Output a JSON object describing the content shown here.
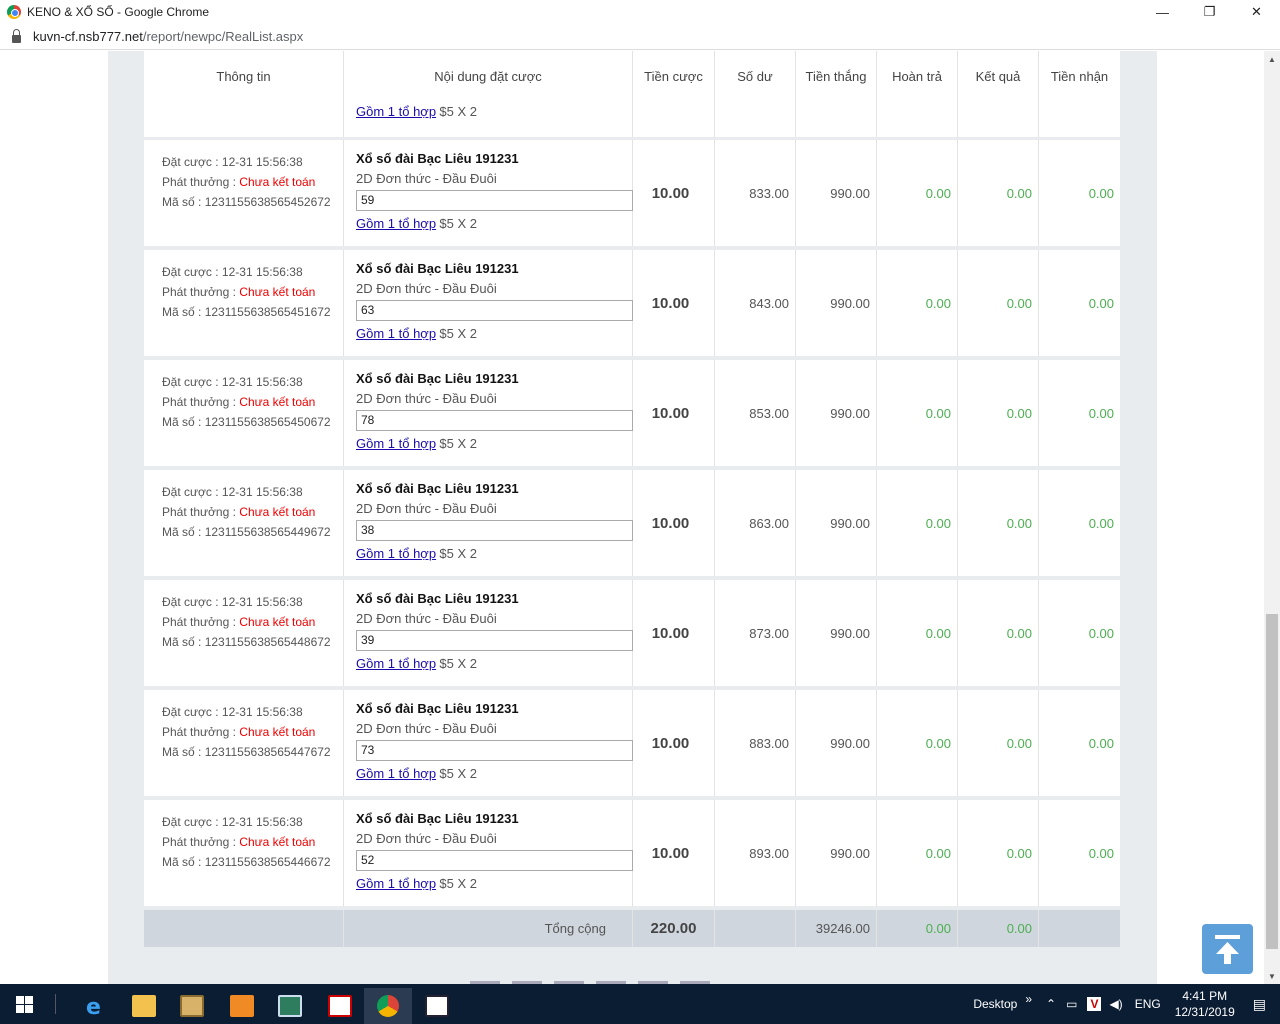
{
  "window": {
    "title": "KENO & XỔ SỐ - Google Chrome",
    "url_host": "kuvn-cf.nsb777.net",
    "url_path": "/report/newpc/RealList.aspx",
    "minimize": "—",
    "restore": "❐",
    "close": "✕"
  },
  "table": {
    "headers": [
      "Thông tin",
      "Nội dung đặt cược",
      "Tiền cược",
      "Số dư",
      "Tiền thắng",
      "Hoàn trả",
      "Kết quả",
      "Tiền nhận"
    ],
    "partial_row": {
      "combo_link": "Gồm 1 tổ hợp",
      "combo_rest": "$5 X 2"
    },
    "rows": [
      {
        "bet_label": "Đặt cược : ",
        "bet_time": "12-31 15:56:38",
        "payout_label": "Phát thưởng : ",
        "payout_status": "Chưa kết toán",
        "code_label": "Mã số : ",
        "code": "1231155638565452672",
        "game": "Xổ số đài Bạc Liêu 191231",
        "kind": "2D Đơn thức - Đầu Đuôi",
        "number": "59",
        "combo_link": "Gồm 1 tổ hợp",
        "combo_rest": "$5 X 2",
        "stake": "10.00",
        "balance": "833.00",
        "win": "990.00",
        "refund": "0.00",
        "result": "0.00",
        "received": "0.00"
      },
      {
        "bet_label": "Đặt cược : ",
        "bet_time": "12-31 15:56:38",
        "payout_label": "Phát thưởng : ",
        "payout_status": "Chưa kết toán",
        "code_label": "Mã số : ",
        "code": "1231155638565451672",
        "game": "Xổ số đài Bạc Liêu 191231",
        "kind": "2D Đơn thức - Đầu Đuôi",
        "number": "63",
        "combo_link": "Gồm 1 tổ hợp",
        "combo_rest": "$5 X 2",
        "stake": "10.00",
        "balance": "843.00",
        "win": "990.00",
        "refund": "0.00",
        "result": "0.00",
        "received": "0.00"
      },
      {
        "bet_label": "Đặt cược : ",
        "bet_time": "12-31 15:56:38",
        "payout_label": "Phát thưởng : ",
        "payout_status": "Chưa kết toán",
        "code_label": "Mã số : ",
        "code": "1231155638565450672",
        "game": "Xổ số đài Bạc Liêu 191231",
        "kind": "2D Đơn thức - Đầu Đuôi",
        "number": "78",
        "combo_link": "Gồm 1 tổ hợp",
        "combo_rest": "$5 X 2",
        "stake": "10.00",
        "balance": "853.00",
        "win": "990.00",
        "refund": "0.00",
        "result": "0.00",
        "received": "0.00"
      },
      {
        "bet_label": "Đặt cược : ",
        "bet_time": "12-31 15:56:38",
        "payout_label": "Phát thưởng : ",
        "payout_status": "Chưa kết toán",
        "code_label": "Mã số : ",
        "code": "1231155638565449672",
        "game": "Xổ số đài Bạc Liêu 191231",
        "kind": "2D Đơn thức - Đầu Đuôi",
        "number": "38",
        "combo_link": "Gồm 1 tổ hợp",
        "combo_rest": "$5 X 2",
        "stake": "10.00",
        "balance": "863.00",
        "win": "990.00",
        "refund": "0.00",
        "result": "0.00",
        "received": "0.00"
      },
      {
        "bet_label": "Đặt cược : ",
        "bet_time": "12-31 15:56:38",
        "payout_label": "Phát thưởng : ",
        "payout_status": "Chưa kết toán",
        "code_label": "Mã số : ",
        "code": "1231155638565448672",
        "game": "Xổ số đài Bạc Liêu 191231",
        "kind": "2D Đơn thức - Đầu Đuôi",
        "number": "39",
        "combo_link": "Gồm 1 tổ hợp",
        "combo_rest": "$5 X 2",
        "stake": "10.00",
        "balance": "873.00",
        "win": "990.00",
        "refund": "0.00",
        "result": "0.00",
        "received": "0.00"
      },
      {
        "bet_label": "Đặt cược : ",
        "bet_time": "12-31 15:56:38",
        "payout_label": "Phát thưởng : ",
        "payout_status": "Chưa kết toán",
        "code_label": "Mã số : ",
        "code": "1231155638565447672",
        "game": "Xổ số đài Bạc Liêu 191231",
        "kind": "2D Đơn thức - Đầu Đuôi",
        "number": "73",
        "combo_link": "Gồm 1 tổ hợp",
        "combo_rest": "$5 X 2",
        "stake": "10.00",
        "balance": "883.00",
        "win": "990.00",
        "refund": "0.00",
        "result": "0.00",
        "received": "0.00"
      },
      {
        "bet_label": "Đặt cược : ",
        "bet_time": "12-31 15:56:38",
        "payout_label": "Phát thưởng : ",
        "payout_status": "Chưa kết toán",
        "code_label": "Mã số : ",
        "code": "1231155638565446672",
        "game": "Xổ số đài Bạc Liêu 191231",
        "kind": "2D Đơn thức - Đầu Đuôi",
        "number": "52",
        "combo_link": "Gồm 1 tổ hợp",
        "combo_rest": "$5 X 2",
        "stake": "10.00",
        "balance": "893.00",
        "win": "990.00",
        "refund": "0.00",
        "result": "0.00",
        "received": "0.00"
      }
    ],
    "total": {
      "label": "Tổng cộng",
      "stake": "220.00",
      "balance": "",
      "win": "39246.00",
      "refund": "0.00",
      "result": "0.00",
      "received": ""
    }
  },
  "taskbar": {
    "desktop_label": "Desktop",
    "chevron": "»",
    "lang": "ENG",
    "time": "4:41 PM",
    "date": "12/31/2019"
  },
  "colors": {
    "status_red": "#ee0000",
    "value_green": "#4caf50",
    "link_blue": "#1a0dab",
    "panel_bg": "#e9ecef",
    "total_bg": "#cfd6de",
    "to_top_button": "#5d9fd8",
    "taskbar_bg": "#0b1d33"
  },
  "icons": [
    "chrome-icon",
    "lock-icon",
    "windows-start-icon",
    "edge-icon",
    "file-explorer-icon",
    "photos-icon",
    "pdf-icon",
    "tablet-icon",
    "acrobat-icon",
    "chrome-taskbar-icon",
    "image-viewer-icon",
    "scroll-to-top-icon",
    "notification-icon"
  ]
}
